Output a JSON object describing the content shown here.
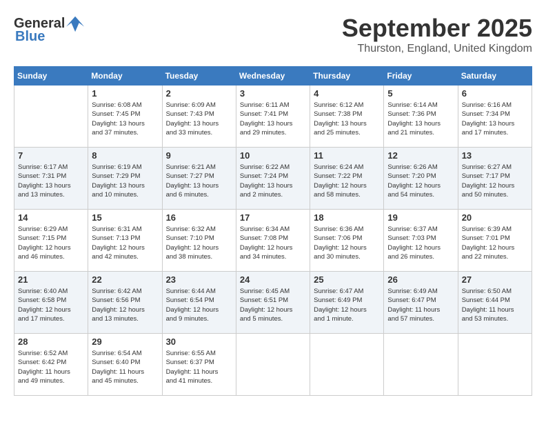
{
  "logo": {
    "general": "General",
    "blue": "Blue"
  },
  "header": {
    "month": "September 2025",
    "location": "Thurston, England, United Kingdom"
  },
  "days": [
    "Sunday",
    "Monday",
    "Tuesday",
    "Wednesday",
    "Thursday",
    "Friday",
    "Saturday"
  ],
  "weeks": [
    [
      {
        "day": "",
        "info": ""
      },
      {
        "day": "1",
        "info": "Sunrise: 6:08 AM\nSunset: 7:45 PM\nDaylight: 13 hours\nand 37 minutes."
      },
      {
        "day": "2",
        "info": "Sunrise: 6:09 AM\nSunset: 7:43 PM\nDaylight: 13 hours\nand 33 minutes."
      },
      {
        "day": "3",
        "info": "Sunrise: 6:11 AM\nSunset: 7:41 PM\nDaylight: 13 hours\nand 29 minutes."
      },
      {
        "day": "4",
        "info": "Sunrise: 6:12 AM\nSunset: 7:38 PM\nDaylight: 13 hours\nand 25 minutes."
      },
      {
        "day": "5",
        "info": "Sunrise: 6:14 AM\nSunset: 7:36 PM\nDaylight: 13 hours\nand 21 minutes."
      },
      {
        "day": "6",
        "info": "Sunrise: 6:16 AM\nSunset: 7:34 PM\nDaylight: 13 hours\nand 17 minutes."
      }
    ],
    [
      {
        "day": "7",
        "info": "Sunrise: 6:17 AM\nSunset: 7:31 PM\nDaylight: 13 hours\nand 13 minutes."
      },
      {
        "day": "8",
        "info": "Sunrise: 6:19 AM\nSunset: 7:29 PM\nDaylight: 13 hours\nand 10 minutes."
      },
      {
        "day": "9",
        "info": "Sunrise: 6:21 AM\nSunset: 7:27 PM\nDaylight: 13 hours\nand 6 minutes."
      },
      {
        "day": "10",
        "info": "Sunrise: 6:22 AM\nSunset: 7:24 PM\nDaylight: 13 hours\nand 2 minutes."
      },
      {
        "day": "11",
        "info": "Sunrise: 6:24 AM\nSunset: 7:22 PM\nDaylight: 12 hours\nand 58 minutes."
      },
      {
        "day": "12",
        "info": "Sunrise: 6:26 AM\nSunset: 7:20 PM\nDaylight: 12 hours\nand 54 minutes."
      },
      {
        "day": "13",
        "info": "Sunrise: 6:27 AM\nSunset: 7:17 PM\nDaylight: 12 hours\nand 50 minutes."
      }
    ],
    [
      {
        "day": "14",
        "info": "Sunrise: 6:29 AM\nSunset: 7:15 PM\nDaylight: 12 hours\nand 46 minutes."
      },
      {
        "day": "15",
        "info": "Sunrise: 6:31 AM\nSunset: 7:13 PM\nDaylight: 12 hours\nand 42 minutes."
      },
      {
        "day": "16",
        "info": "Sunrise: 6:32 AM\nSunset: 7:10 PM\nDaylight: 12 hours\nand 38 minutes."
      },
      {
        "day": "17",
        "info": "Sunrise: 6:34 AM\nSunset: 7:08 PM\nDaylight: 12 hours\nand 34 minutes."
      },
      {
        "day": "18",
        "info": "Sunrise: 6:36 AM\nSunset: 7:06 PM\nDaylight: 12 hours\nand 30 minutes."
      },
      {
        "day": "19",
        "info": "Sunrise: 6:37 AM\nSunset: 7:03 PM\nDaylight: 12 hours\nand 26 minutes."
      },
      {
        "day": "20",
        "info": "Sunrise: 6:39 AM\nSunset: 7:01 PM\nDaylight: 12 hours\nand 22 minutes."
      }
    ],
    [
      {
        "day": "21",
        "info": "Sunrise: 6:40 AM\nSunset: 6:58 PM\nDaylight: 12 hours\nand 17 minutes."
      },
      {
        "day": "22",
        "info": "Sunrise: 6:42 AM\nSunset: 6:56 PM\nDaylight: 12 hours\nand 13 minutes."
      },
      {
        "day": "23",
        "info": "Sunrise: 6:44 AM\nSunset: 6:54 PM\nDaylight: 12 hours\nand 9 minutes."
      },
      {
        "day": "24",
        "info": "Sunrise: 6:45 AM\nSunset: 6:51 PM\nDaylight: 12 hours\nand 5 minutes."
      },
      {
        "day": "25",
        "info": "Sunrise: 6:47 AM\nSunset: 6:49 PM\nDaylight: 12 hours\nand 1 minute."
      },
      {
        "day": "26",
        "info": "Sunrise: 6:49 AM\nSunset: 6:47 PM\nDaylight: 11 hours\nand 57 minutes."
      },
      {
        "day": "27",
        "info": "Sunrise: 6:50 AM\nSunset: 6:44 PM\nDaylight: 11 hours\nand 53 minutes."
      }
    ],
    [
      {
        "day": "28",
        "info": "Sunrise: 6:52 AM\nSunset: 6:42 PM\nDaylight: 11 hours\nand 49 minutes."
      },
      {
        "day": "29",
        "info": "Sunrise: 6:54 AM\nSunset: 6:40 PM\nDaylight: 11 hours\nand 45 minutes."
      },
      {
        "day": "30",
        "info": "Sunrise: 6:55 AM\nSunset: 6:37 PM\nDaylight: 11 hours\nand 41 minutes."
      },
      {
        "day": "",
        "info": ""
      },
      {
        "day": "",
        "info": ""
      },
      {
        "day": "",
        "info": ""
      },
      {
        "day": "",
        "info": ""
      }
    ]
  ]
}
